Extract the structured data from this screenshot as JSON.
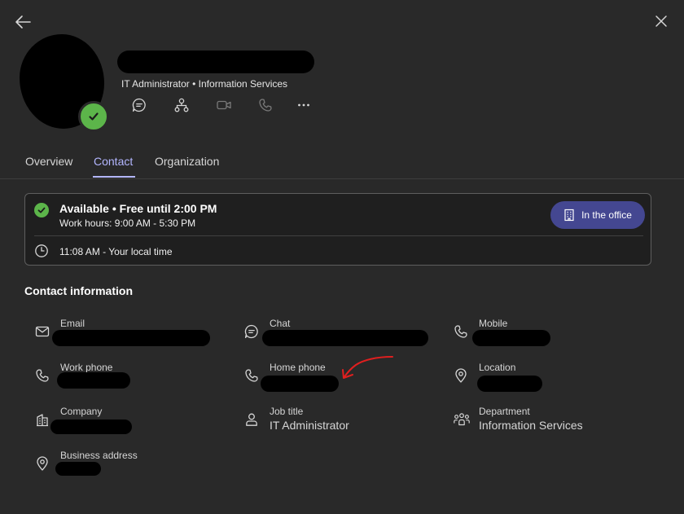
{
  "header": {
    "subtitle": "IT Administrator • Information Services",
    "actions": [
      "chat-icon",
      "org-chart-icon",
      "video-call-icon",
      "call-icon",
      "more-icon"
    ]
  },
  "tabs": [
    {
      "label": "Overview",
      "active": false
    },
    {
      "label": "Contact",
      "active": true
    },
    {
      "label": "Organization",
      "active": false
    }
  ],
  "availability": {
    "status": "Available • Free until 2:00 PM",
    "work_hours": "Work hours: 9:00 AM - 5:30 PM",
    "local_time": "11:08 AM - Your local time",
    "location_button": "In the office"
  },
  "contact": {
    "title": "Contact information",
    "fields": {
      "email": {
        "label": "Email",
        "value": ""
      },
      "chat": {
        "label": "Chat",
        "value": ""
      },
      "mobile": {
        "label": "Mobile",
        "value": ""
      },
      "work_phone": {
        "label": "Work phone",
        "value": ""
      },
      "home_phone": {
        "label": "Home phone",
        "value": ""
      },
      "location": {
        "label": "Location",
        "value": ""
      },
      "company": {
        "label": "Company",
        "value": ""
      },
      "job_title": {
        "label": "Job title",
        "value": "IT Administrator"
      },
      "department": {
        "label": "Department",
        "value": "Information Services"
      },
      "business_address": {
        "label": "Business address",
        "value": ""
      }
    }
  },
  "colors": {
    "background": "#292929",
    "accent": "#b3b6ff",
    "available": "#5cb54a",
    "pill": "#444791",
    "annotation": "#e01f1f"
  }
}
